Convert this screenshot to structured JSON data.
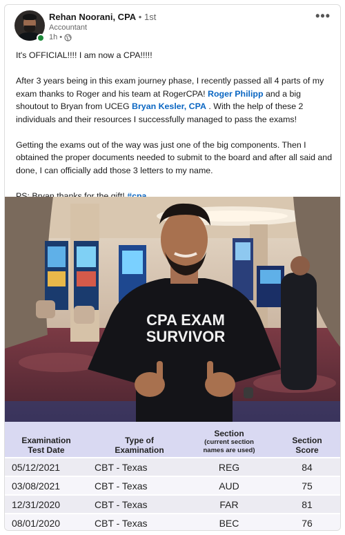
{
  "author": {
    "name": "Rehan Noorani, CPA",
    "degree": "• 1st",
    "headline": "Accountant",
    "time": "1h •"
  },
  "post": {
    "line1": "It's OFFICIAL!!!! I am now a CPA!!!!!",
    "para2_a": "After 3 years being in this exam journey phase, I recently passed all 4 parts of my exam thanks to Roger and his team at RogerCPA! ",
    "mention1": "Roger Philipp",
    "para2_b": " and a big shoutout to Bryan from UCEG ",
    "mention2": "Bryan Kesler, CPA",
    "para2_c": " . With the help of these 2 individuals and their resources I successfully managed to pass the exams!",
    "para3": "Getting the exams out of the way was just one of the big components. Then I obtained the proper documents needed to submit to the board and after all said and done, I can officially add those 3 letters to my name.",
    "ps": "PS: Bryan thanks for the gift! ",
    "hashtag": "#cpa"
  },
  "photo": {
    "shirt_line1": "CPA EXAM",
    "shirt_line2": "SURVIVOR"
  },
  "table": {
    "headers": {
      "date_a": "Examination",
      "date_b": "Test Date",
      "type_a": "Type of",
      "type_b": "Examination",
      "section_a": "Section",
      "section_b": "(current section",
      "section_c": "names are used)",
      "score_a": "Section",
      "score_b": "Score"
    },
    "rows": [
      {
        "date": "05/12/2021",
        "type": "CBT - Texas",
        "section": "REG",
        "score": "84"
      },
      {
        "date": "03/08/2021",
        "type": "CBT - Texas",
        "section": "AUD",
        "score": "75"
      },
      {
        "date": "12/31/2020",
        "type": "CBT - Texas",
        "section": "FAR",
        "score": "81"
      },
      {
        "date": "08/01/2020",
        "type": "CBT - Texas",
        "section": "BEC",
        "score": "76"
      }
    ]
  },
  "colors": {
    "link": "#0a66c2",
    "table_header": "#d9d9f2",
    "online": "#1d8a3a"
  }
}
